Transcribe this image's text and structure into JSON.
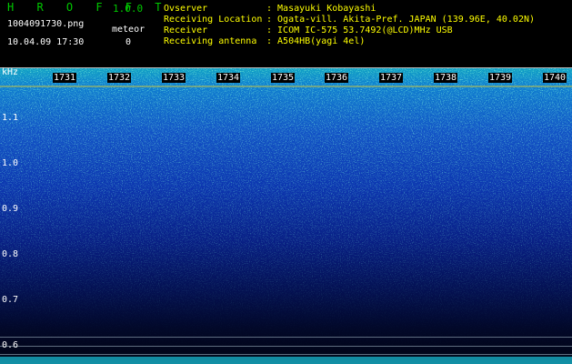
{
  "app": {
    "title": "H R O F F T",
    "version": "1.0.0"
  },
  "file": {
    "name": "1004091730.png",
    "datetime": "10.04.09 17:30"
  },
  "meteor": {
    "label": "meteor",
    "count": "0"
  },
  "info": [
    {
      "label": "Ovserver",
      "value": ": Masayuki Kobayashi"
    },
    {
      "label": "Receiving Location",
      "value": ": Ogata-vill. Akita-Pref. JAPAN (139.96E, 40.02N)"
    },
    {
      "label": "Receiver",
      "value": ": ICOM IC-575 53.7492(@LCD)MHz USB"
    },
    {
      "label": "Receiving antenna",
      "value": ": A504HB(yagi 4el)"
    }
  ],
  "axis": {
    "unit": "kHz",
    "time_ticks": [
      "1731",
      "1732",
      "1733",
      "1734",
      "1735",
      "1736",
      "1737",
      "1738",
      "1739",
      "1740"
    ],
    "freq_ticks": [
      "1.1",
      "1.0",
      "0.9",
      "0.8",
      "0.7",
      "0.6"
    ]
  },
  "colors": {
    "title": "#00c800",
    "header_text": "#ffffff",
    "info_text": "#ffff00",
    "spectrum_bright": "#00ffd2",
    "spectrum_dark": "#02082a"
  }
}
